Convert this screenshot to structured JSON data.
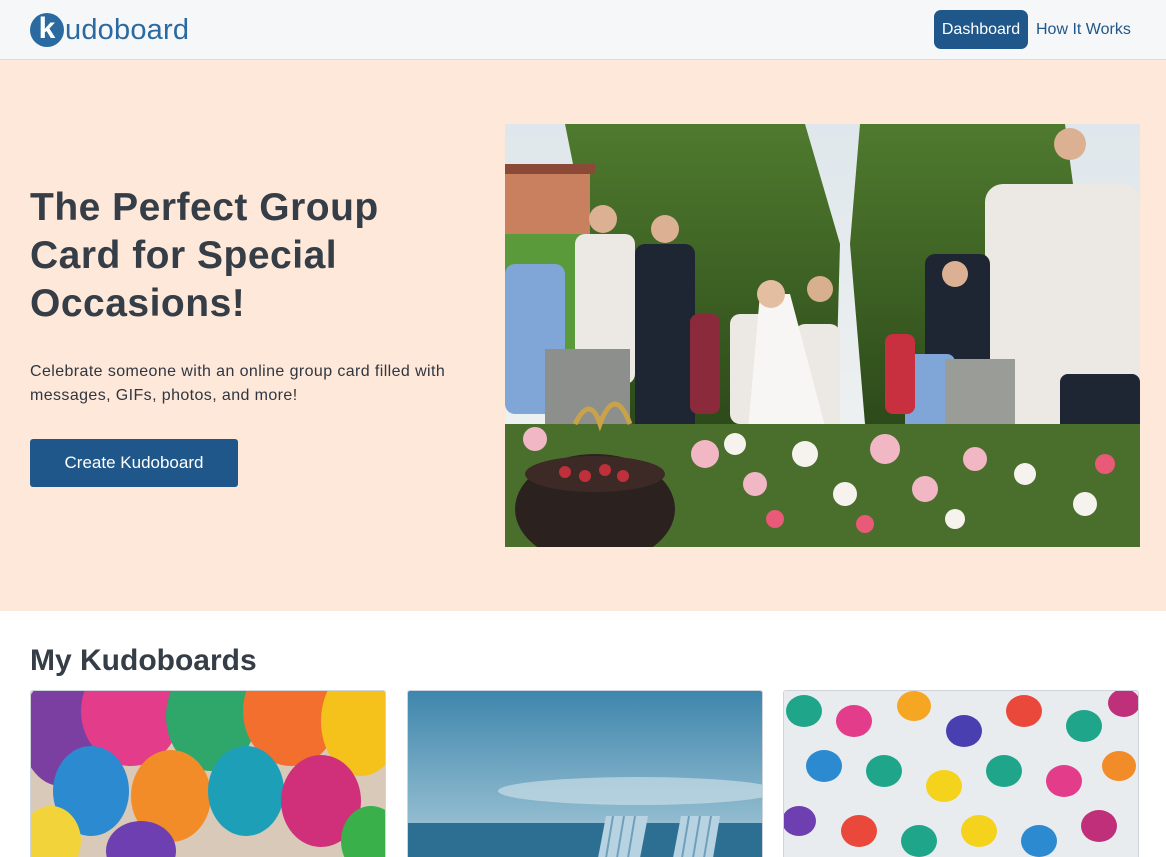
{
  "navbar": {
    "logo_letter": "k",
    "logo_text": "udoboard",
    "dashboard_label": "Dashboard",
    "how_it_works_label": "How It Works"
  },
  "hero": {
    "title": "The Perfect Group Card for Special Occasions!",
    "subtitle": "Celebrate someone with an online group card filled with messages, GIFs, photos, and more!",
    "cta_label": "Create Kudoboard"
  },
  "boards": {
    "title": "My Kudoboards",
    "cards": [
      {
        "theme": "colorful-balloons-image"
      },
      {
        "theme": "beach-chairs-image"
      },
      {
        "theme": "balloons-overhead-image"
      }
    ]
  },
  "colors": {
    "brand_blue": "#20578a",
    "hero_background": "#fee8d9",
    "navbar_background": "#f6f7f9"
  }
}
